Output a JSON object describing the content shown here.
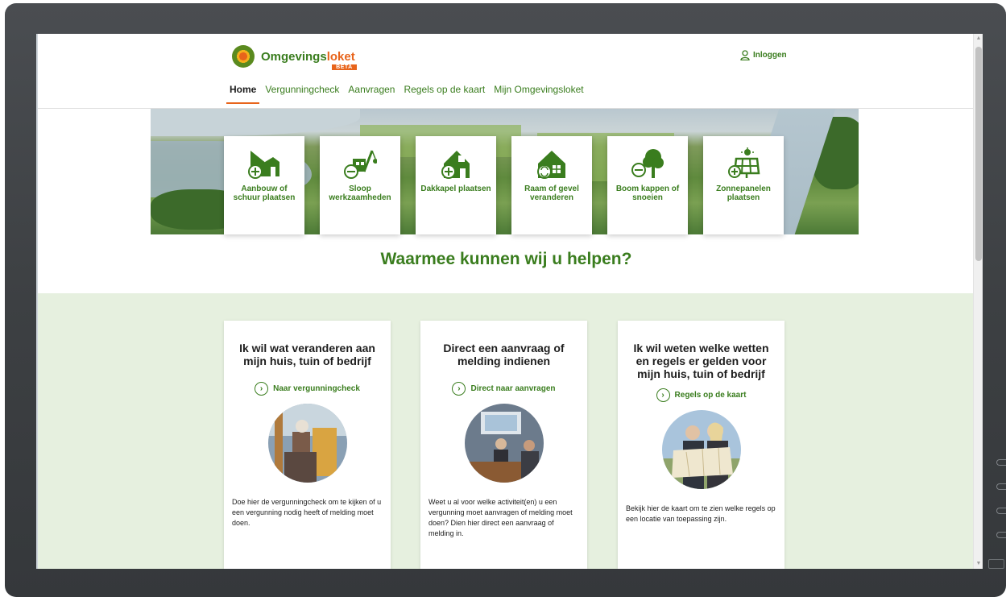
{
  "header": {
    "logo_main": "Omgevings",
    "logo_accent": "loket",
    "logo_badge": "BETA",
    "login_label": "Inloggen"
  },
  "nav": [
    {
      "label": "Home",
      "active": true
    },
    {
      "label": "Vergunningcheck",
      "active": false
    },
    {
      "label": "Aanvragen",
      "active": false
    },
    {
      "label": "Regels op de kaart",
      "active": false
    },
    {
      "label": "Mijn Omgevingsloket",
      "active": false
    }
  ],
  "tiles": [
    {
      "label": "Aanbouw of schuur plaatsen",
      "icon": "house-extension-icon"
    },
    {
      "label": "Sloop werkzaamheden",
      "icon": "demolition-crane-icon"
    },
    {
      "label": "Dakkapel plaatsen",
      "icon": "dormer-house-icon"
    },
    {
      "label": "Raam of gevel veranderen",
      "icon": "window-facade-icon"
    },
    {
      "label": "Boom kappen of snoeien",
      "icon": "tree-icon"
    },
    {
      "label": "Zonnepanelen plaatsen",
      "icon": "solar-panel-icon"
    }
  ],
  "help_title": "Waarmee kunnen wij u helpen?",
  "cards": [
    {
      "title": "Ik wil wat veranderen aan mijn huis, tuin of bedrijf",
      "link": "Naar vergunningcheck",
      "text": "Doe hier de vergunningcheck om te kijken of u een vergunning nodig heeft of melding moet doen."
    },
    {
      "title": "Direct een aanvraag of melding indienen",
      "link": "Direct naar aanvragen",
      "text": "Weet u al voor welke activiteit(en) u een vergunning moet aanvragen of melding moet doen? Dien hier direct een aanvraag of melding in."
    },
    {
      "title": "Ik wil weten welke wetten en regels er gelden voor mijn huis, tuin of bedrijf",
      "link": "Regels op de kaart",
      "text": "Bekijk hier de kaart om te zien welke regels op een locatie van toepassing zijn."
    }
  ],
  "colors": {
    "brand_green": "#3a7d1e",
    "accent_orange": "#e8641b",
    "band_green": "#e6f0df"
  }
}
